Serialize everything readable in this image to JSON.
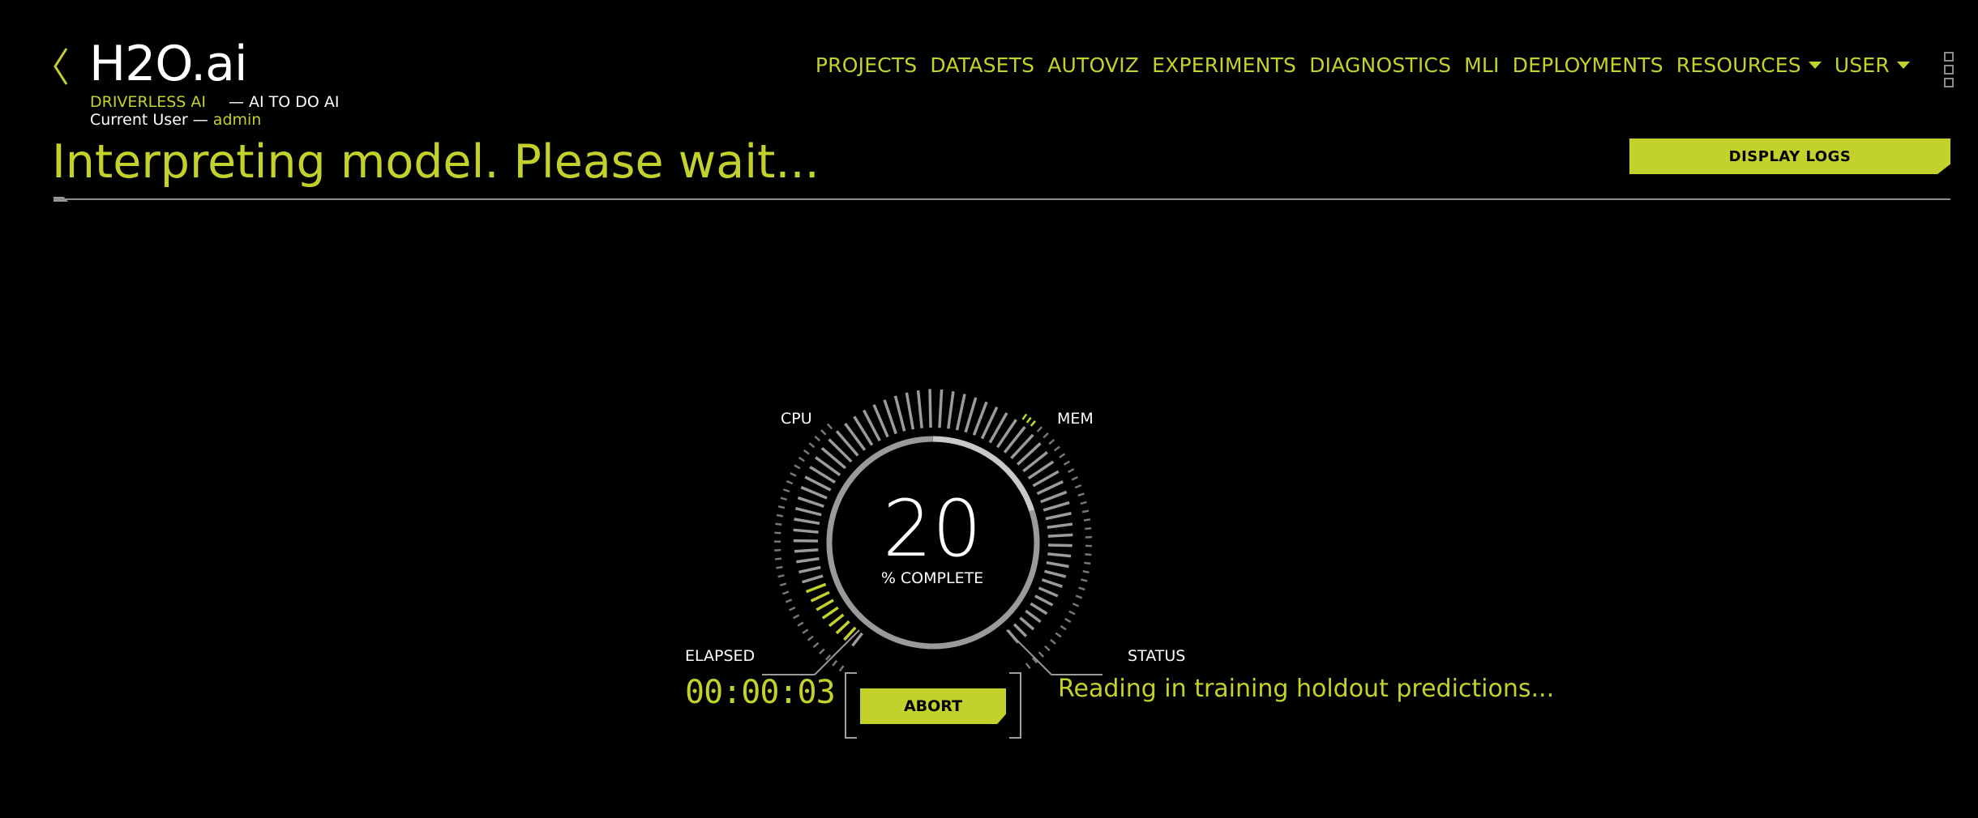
{
  "brand": {
    "logo": "H2O.ai",
    "product": "DRIVERLESS AI",
    "tagline": "— AI TO DO AI",
    "current_user_label": "Current User —",
    "current_user": "admin"
  },
  "nav": {
    "items": [
      {
        "label": "PROJECTS"
      },
      {
        "label": "DATASETS"
      },
      {
        "label": "AUTOVIZ"
      },
      {
        "label": "EXPERIMENTS"
      },
      {
        "label": "DIAGNOSTICS"
      },
      {
        "label": "MLI"
      },
      {
        "label": "DEPLOYMENTS"
      },
      {
        "label": "RESOURCES"
      },
      {
        "label": "USER"
      }
    ]
  },
  "page": {
    "title": "Interpreting model. Please wait...",
    "display_logs": "DISPLAY LOGS"
  },
  "progress": {
    "percent": 20,
    "percent_label": "% COMPLETE",
    "cpu_label": "CPU",
    "mem_label": "MEM",
    "elapsed_label": "ELAPSED",
    "elapsed_value": "00:00:03",
    "status_label": "STATUS",
    "status_value": "Reading in training holdout predictions...",
    "abort": "ABORT"
  },
  "colors": {
    "accent": "#c3d22a",
    "background": "#000000",
    "muted": "#8c8c8c"
  },
  "icons": {
    "back": "chevron-left-icon",
    "apps": "app-grid-icon",
    "dropdown": "caret-down-icon"
  }
}
